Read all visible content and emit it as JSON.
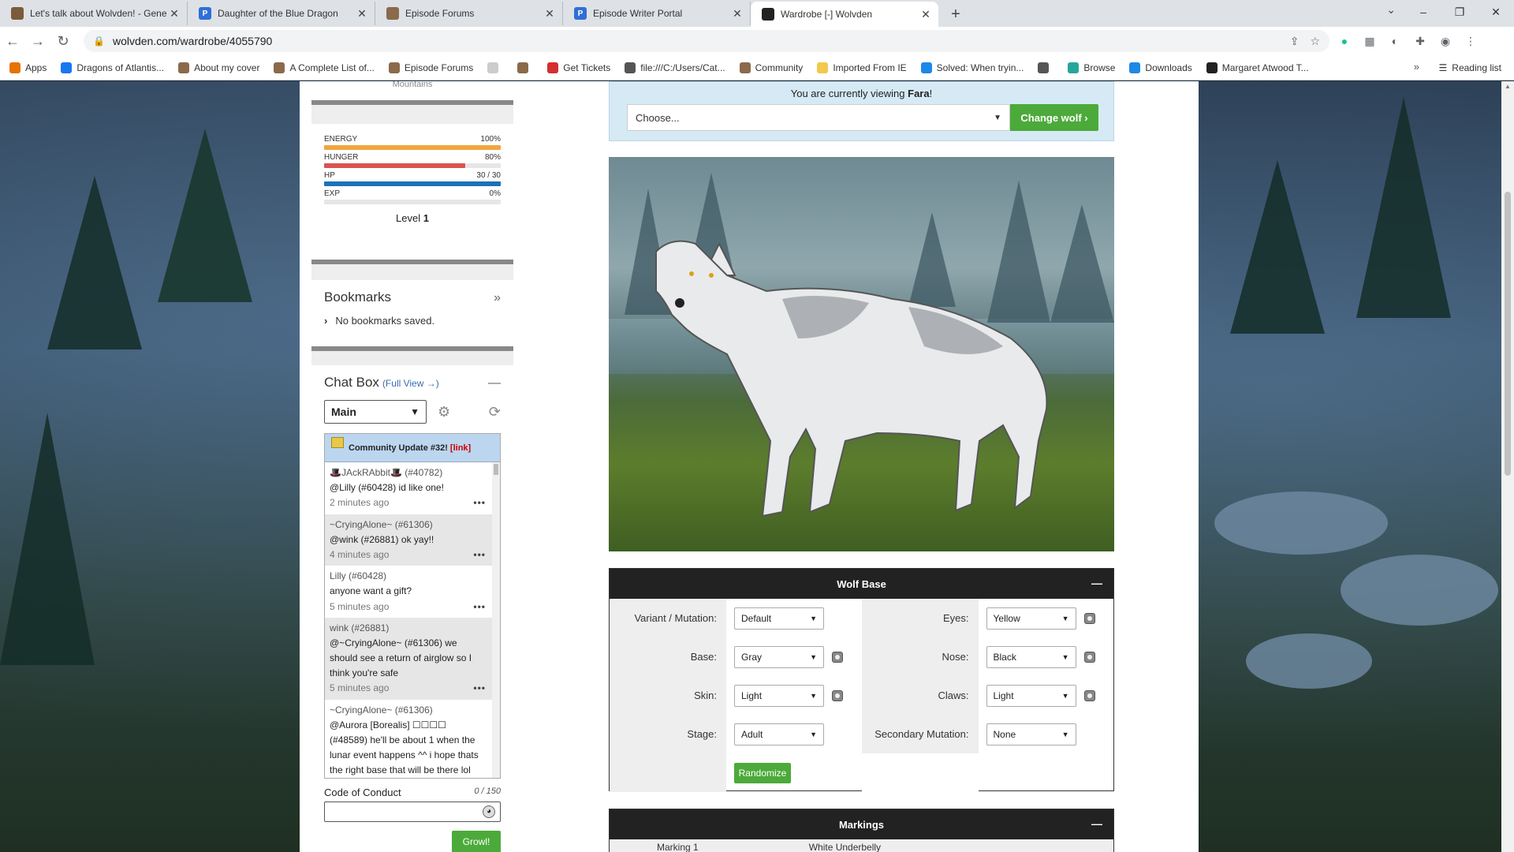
{
  "browser": {
    "tabs": [
      {
        "title": "Let's talk about Wolvden! - Gene",
        "favicon_color": "#7b5b3a",
        "favicon_text": "",
        "active": false
      },
      {
        "title": "Daughter of the Blue Dragon",
        "favicon_color": "#2f6fd6",
        "favicon_text": "P",
        "active": false
      },
      {
        "title": "Episode Forums",
        "favicon_color": "#8a6a4a",
        "favicon_text": "",
        "active": false
      },
      {
        "title": "Episode Writer Portal",
        "favicon_color": "#2f6fd6",
        "favicon_text": "P",
        "active": false
      },
      {
        "title": "Wardrobe [-] Wolvden",
        "favicon_color": "#222222",
        "favicon_text": "",
        "active": true
      }
    ],
    "url": "wolvden.com/wardrobe/4055790",
    "bookmarks": [
      {
        "label": "Apps",
        "color": "#e37400"
      },
      {
        "label": "Dragons of Atlantis...",
        "color": "#1877f2"
      },
      {
        "label": "About my cover",
        "color": "#8a6a4a"
      },
      {
        "label": "A Complete List of...",
        "color": "#8a6a4a"
      },
      {
        "label": "Episode Forums",
        "color": "#8a6a4a"
      },
      {
        "label": "",
        "color": "#cccccc"
      },
      {
        "label": "",
        "color": "#8a6a4a"
      },
      {
        "label": "Get Tickets",
        "color": "#d32f2f"
      },
      {
        "label": "file:///C:/Users/Cat...",
        "color": "#555555"
      },
      {
        "label": "Community",
        "color": "#8a6a4a"
      },
      {
        "label": "Imported From IE",
        "color": "#f2c94c"
      },
      {
        "label": "Solved: When tryin...",
        "color": "#1e88e5"
      },
      {
        "label": "",
        "color": "#555555"
      },
      {
        "label": "Browse",
        "color": "#26a69a"
      },
      {
        "label": "Downloads",
        "color": "#1e88e5"
      },
      {
        "label": "Margaret Atwood T...",
        "color": "#222222"
      }
    ],
    "reading_list": "Reading list"
  },
  "sidebar": {
    "top_text": "Mountains",
    "stats": [
      {
        "label": "ENERGY",
        "value": "100%",
        "fraction": 1.0,
        "color": "#f0a640"
      },
      {
        "label": "HUNGER",
        "value": "80%",
        "fraction": 0.8,
        "color": "#d9534f"
      },
      {
        "label": "HP",
        "value": "30 / 30",
        "fraction": 1.0,
        "color": "#1a73b8"
      },
      {
        "label": "EXP",
        "value": "0%",
        "fraction": 0.0,
        "color": "#999999"
      }
    ],
    "level_label": "Level",
    "level_value": "1",
    "bookmarks_title": "Bookmarks",
    "bookmarks_empty": "No bookmarks saved.",
    "chat": {
      "title": "Chat Box",
      "full_view": "(Full View →)",
      "room": "Main",
      "announcement": "Community Update #32!",
      "announcement_link": "[link]",
      "messages": [
        {
          "who": "🎩JAckRAbbit🎩 (#40782)",
          "text": "@Lilly (#60428) id like one!",
          "time": "2 minutes ago"
        },
        {
          "who": "~CryingAlone~ (#61306)",
          "text": "@wink (#26881) ok yay!!",
          "time": "4 minutes ago"
        },
        {
          "who": "Lilly (#60428)",
          "text": "anyone want a gift?",
          "time": "5 minutes ago"
        },
        {
          "who": "wink (#26881)",
          "text": "@~CryingAlone~ (#61306) we should see a return of airglow so I think you're safe",
          "time": "5 minutes ago"
        },
        {
          "who": "~CryingAlone~ (#61306)",
          "text": "@Aurora [Borealis] ☐☐☐☐ (#48589) he'll be about 1 when the lunar event happens ^^ i hope thats the right base that will be there lol",
          "time": ""
        }
      ],
      "code_of_conduct": "Code of Conduct",
      "char_count": "0 / 150",
      "growl": "Growl!"
    }
  },
  "main": {
    "viewing_prefix": "You are currently viewing ",
    "viewing_name": "Fara",
    "viewing_suffix": "!",
    "choose_placeholder": "Choose...",
    "change_wolf": "Change wolf ›",
    "wolf_base": {
      "title": "Wolf Base",
      "left": [
        {
          "label": "Variant / Mutation:",
          "value": "Default",
          "dice": false
        },
        {
          "label": "Base:",
          "value": "Gray",
          "dice": true
        },
        {
          "label": "Skin:",
          "value": "Light",
          "dice": true
        },
        {
          "label": "Stage:",
          "value": "Adult",
          "dice": false
        }
      ],
      "right": [
        {
          "label": "Eyes:",
          "value": "Yellow",
          "dice": true
        },
        {
          "label": "Nose:",
          "value": "Black",
          "dice": true
        },
        {
          "label": "Claws:",
          "value": "Light",
          "dice": true
        },
        {
          "label": "Secondary Mutation:",
          "value": "None",
          "dice": false
        }
      ],
      "randomize": "Randomize"
    },
    "markings": {
      "title": "Markings",
      "first_label": "Marking 1",
      "first_value": "White Underbelly"
    }
  }
}
